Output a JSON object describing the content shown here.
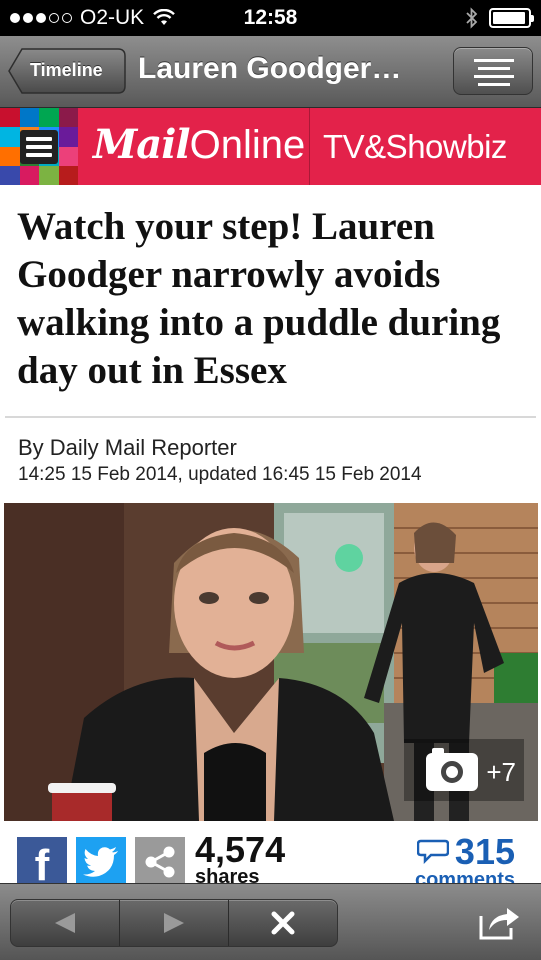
{
  "status_bar": {
    "carrier": "O2-UK",
    "time": "12:58",
    "signal_bars_filled": 3,
    "signal_bars_total": 5,
    "battery_level_percent": 95
  },
  "nav": {
    "back_label": "Timeline",
    "title": "Lauren Goodger…",
    "menu_icon": "reader-icon"
  },
  "site_header": {
    "logo_bold": "Mail",
    "logo_light": "Online",
    "section": "TV&Showbiz",
    "brand_color": "#e3224a"
  },
  "article": {
    "headline": "Watch your step! Lauren Goodger narrowly avoids walking into a puddle during day out in Essex",
    "byline": "By Daily Mail Reporter",
    "dateline": "14:25 15 Feb 2014, updated 16:45 15 Feb 2014",
    "gallery_extra": "+7"
  },
  "share": {
    "facebook_label": "f",
    "shares_count": "4,574",
    "shares_label": "shares",
    "comments_count": "315",
    "comments_label": "comments"
  },
  "toolbar": {
    "back_icon": "back-arrow-icon",
    "forward_icon": "forward-arrow-icon",
    "close_icon": "close-icon",
    "share_icon": "share-out-icon"
  }
}
